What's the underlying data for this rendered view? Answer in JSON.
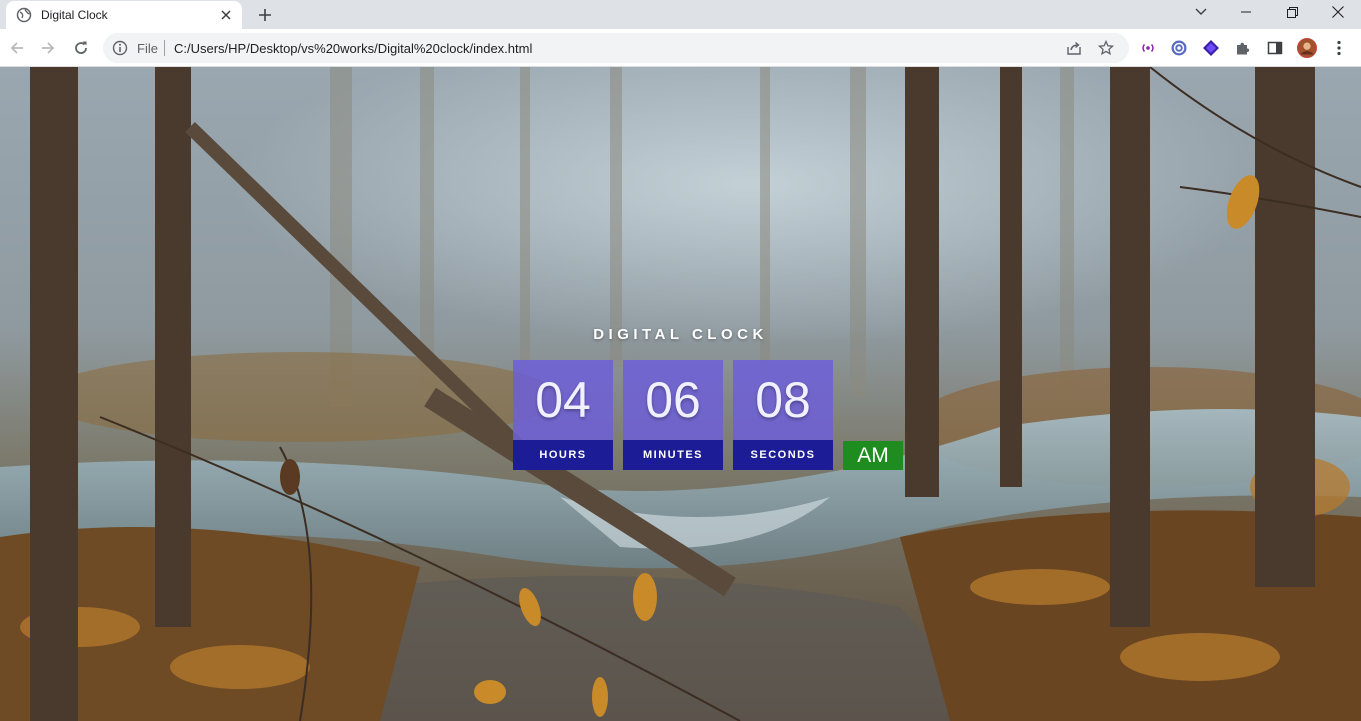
{
  "browser": {
    "tab": {
      "title": "Digital Clock"
    },
    "address_bar": {
      "scheme_label": "File",
      "url": "C:/Users/HP/Desktop/vs%20works/Digital%20clock/index.html"
    }
  },
  "page": {
    "heading": "DIGITAL CLOCK",
    "clock": {
      "hours": {
        "value": "04",
        "label": "HOURS"
      },
      "minutes": {
        "value": "06",
        "label": "MINUTES"
      },
      "seconds": {
        "value": "08",
        "label": "SECONDS"
      },
      "period": "AM"
    }
  },
  "colors": {
    "digit_panel": "#6e5fd7",
    "label_bar": "#1c1c96",
    "period_badge": "#1e8c1e",
    "heading_text": "#ffffff"
  }
}
